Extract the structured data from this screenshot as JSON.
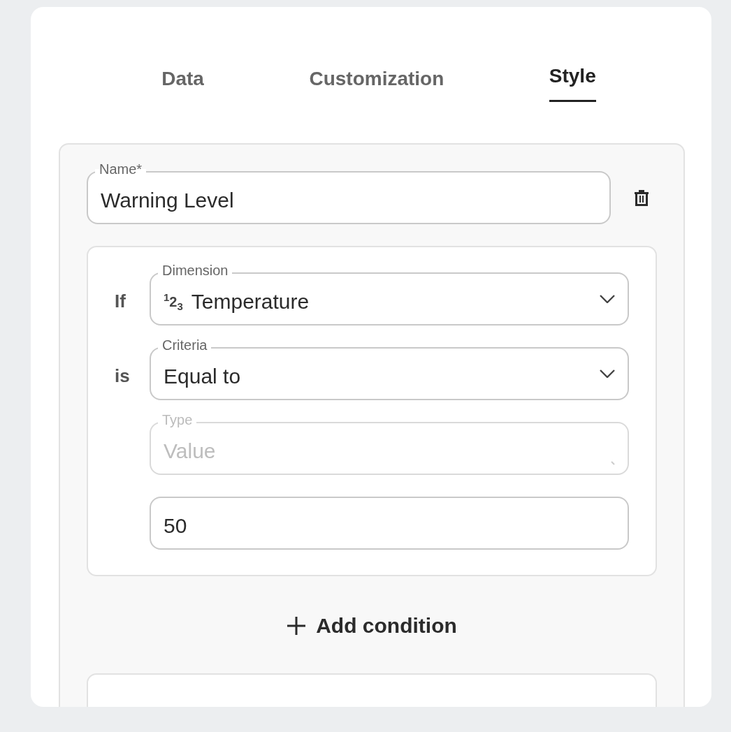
{
  "tabs": [
    {
      "label": "Data",
      "selected": false
    },
    {
      "label": "Customization",
      "selected": false
    },
    {
      "label": "Style",
      "selected": true
    }
  ],
  "rule": {
    "name_field": {
      "label": "Name*",
      "value": "Warning Level"
    },
    "conditions": [
      {
        "prefix": "If",
        "kind": "select",
        "label": "Dimension",
        "type_badge": "$^{1}$2$_{3}$",
        "value": "Temperature",
        "disabled": false
      },
      {
        "prefix": "is",
        "kind": "select",
        "label": "Criteria",
        "value": "Equal to",
        "disabled": false
      },
      {
        "kind": "select",
        "label": "Type",
        "placeholder": "Value",
        "disabled": true
      },
      {
        "kind": "input",
        "value": "50",
        "disabled": false
      }
    ],
    "add_button": "Add condition"
  }
}
